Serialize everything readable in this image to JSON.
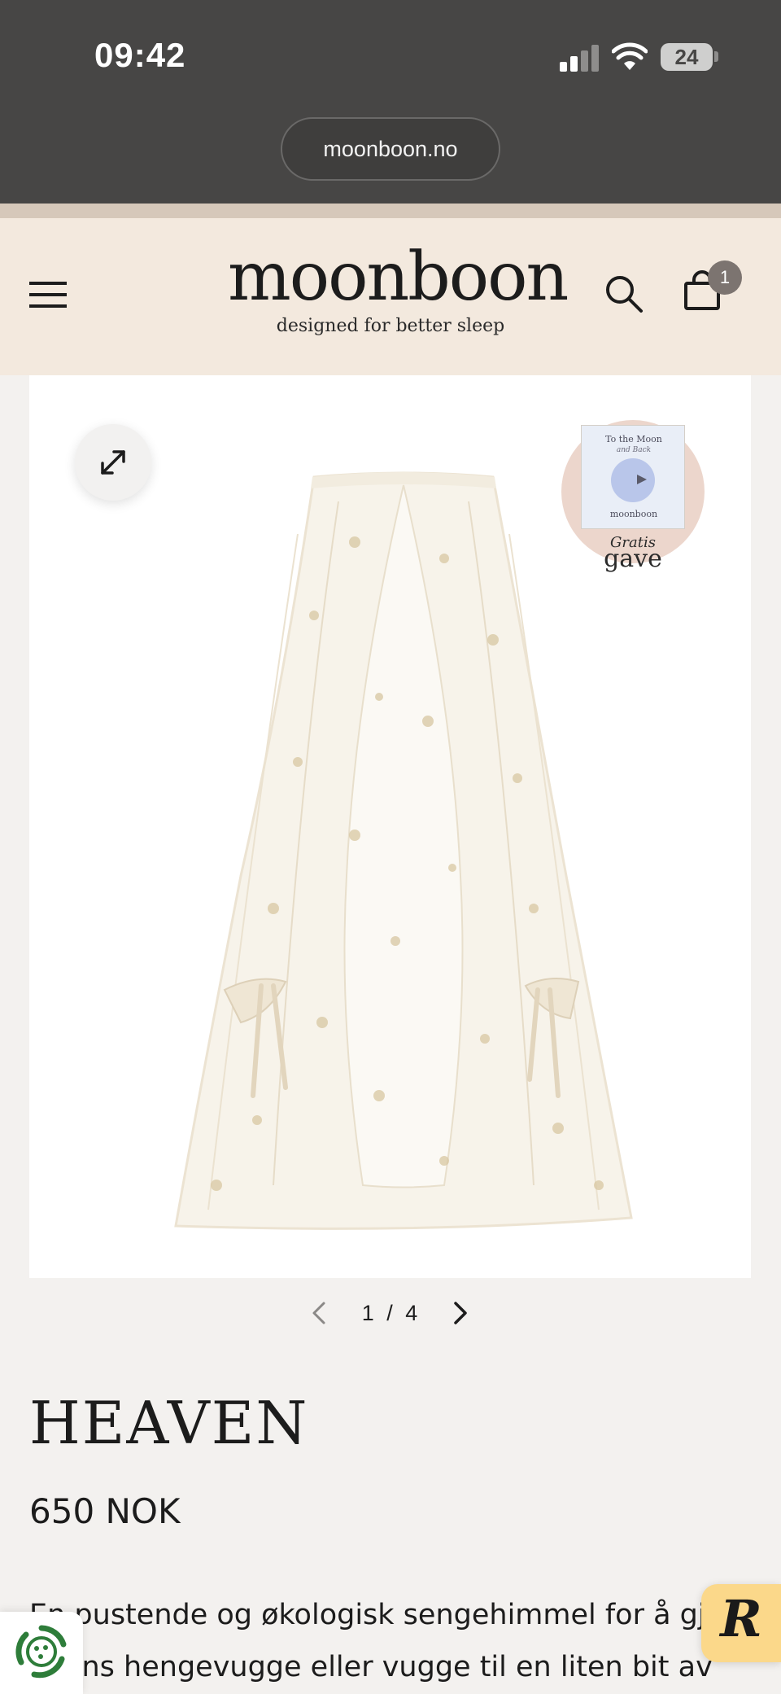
{
  "status_bar": {
    "time": "09:42",
    "battery": "24"
  },
  "browser": {
    "url": "moonboon.no"
  },
  "header": {
    "logo": "moonboon",
    "tagline": "designed for better sleep",
    "cart_count": "1"
  },
  "gallery": {
    "gift_badge": {
      "book_title": "To the Moon",
      "book_subtitle": "and Back",
      "book_brand": "moonboon",
      "label_line1": "Gratis",
      "label_line2": "gave"
    },
    "pager": {
      "current": "1",
      "separator": "/",
      "total": "4"
    }
  },
  "product": {
    "title": "HEAVEN",
    "price": "650 NOK",
    "description_line1": "En pustende og økologisk sengehimmel for å gjør",
    "description_line2": "  yens hengevugge eller vugge til en liten bit av"
  },
  "colors": {
    "status_bg": "#474645",
    "header_bg": "#f3e9de",
    "page_bg": "#f3f1ef",
    "cart_badge": "#7c7470",
    "gift_badge_bg": "#ecd6cc",
    "r_widget_bg": "#fbd88a"
  },
  "icons": [
    "menu-icon",
    "search-icon",
    "cart-icon",
    "expand-icon",
    "chevron-left-icon",
    "chevron-right-icon",
    "eco-icon",
    "r-logo-icon"
  ]
}
